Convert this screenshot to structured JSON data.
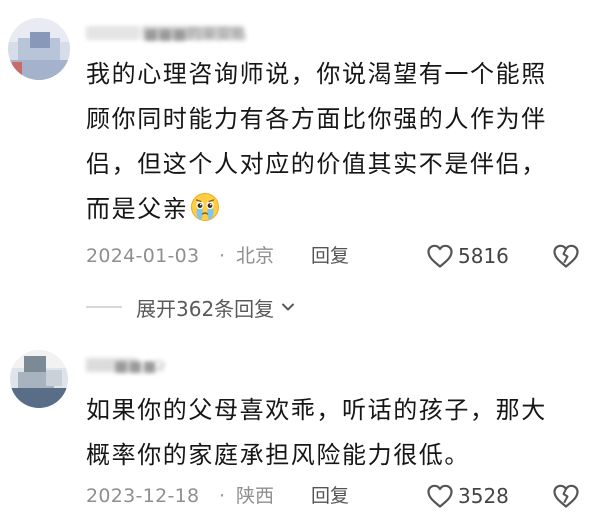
{
  "comments": [
    {
      "username": "■■■的来安格",
      "content_lines": [
        "我的心理咨询师说，你说渴望有一个能照",
        "顾你同时能力有各方面比你强的人作为伴",
        "侣，但这个人对应的价值其实不是伴侣，",
        "而是父亲"
      ],
      "emoji": "crying-face-emoji",
      "date": "2024-01-03",
      "separator": "·",
      "location": "北京",
      "reply_label": "回复",
      "likes": "5816",
      "expand_label": "展开362条回复"
    },
    {
      "username": "■■■冰",
      "content_lines": [
        "如果你的父母喜欢乖，听话的孩子，那大",
        "概率你的家庭承担风险能力很低。"
      ],
      "date": "2023-12-18",
      "separator": "·",
      "location": "陕西",
      "reply_label": "回复",
      "likes": "3528"
    }
  ],
  "colors": {
    "text": "#161616",
    "meta": "#8f8f8f",
    "icon": "#555555",
    "background": "#ffffff"
  }
}
